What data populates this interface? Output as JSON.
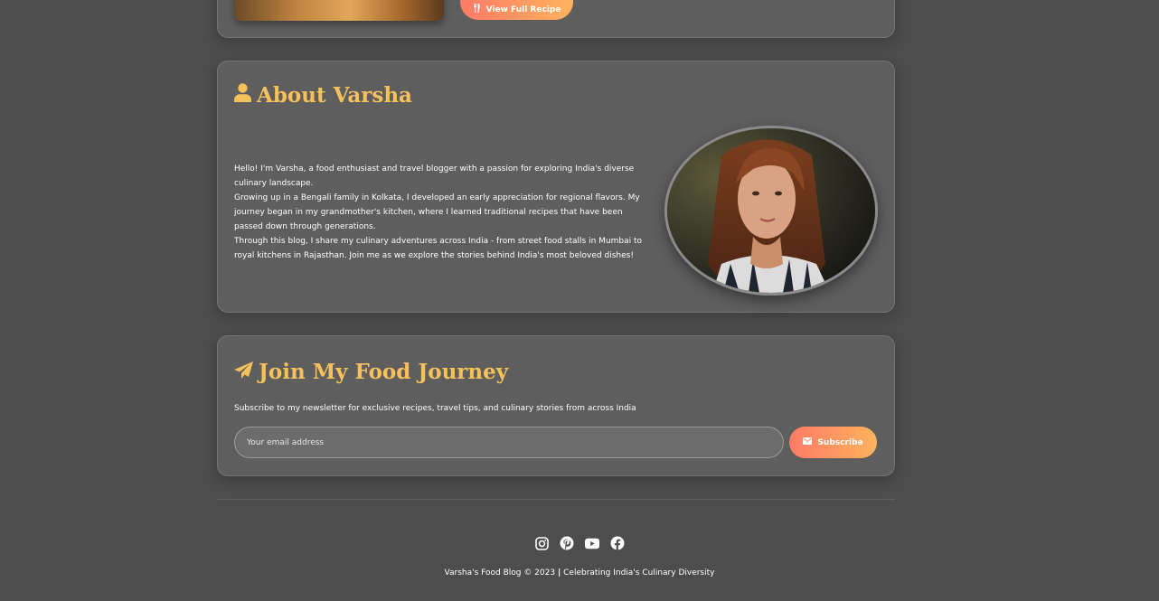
{
  "recipe_card": {
    "button_label": "View Full Recipe",
    "button_icon": "utensils-icon"
  },
  "about": {
    "title": "About Varsha",
    "title_icon": "user-icon",
    "paragraphs": [
      "Hello! I'm Varsha, a food enthusiast and travel blogger with a passion for exploring India's diverse culinary landscape.",
      "Growing up in a Bengali family in Kolkata, I developed an early appreciation for regional flavors. My journey began in my grandmother's kitchen, where I learned traditional recipes that have been passed down through generations.",
      "Through this blog, I share my culinary adventures across India - from street food stalls in Mumbai to royal kitchens in Rajasthan. Join me as we explore the stories behind India's most beloved dishes!"
    ]
  },
  "newsletter": {
    "title": "Join My Food Journey",
    "title_icon": "paper-plane-icon",
    "description": "Subscribe to my newsletter for exclusive recipes, travel tips, and culinary stories from across India",
    "email_placeholder": "Your email address",
    "subscribe_label": "Subscribe",
    "subscribe_icon": "envelope-icon"
  },
  "footer": {
    "socials": [
      "instagram-icon",
      "pinterest-icon",
      "youtube-icon",
      "facebook-icon"
    ],
    "copyright": "Varsha's Food Blog © 2023",
    "separator": "|",
    "tagline": "Celebrating India's Culinary Diversity"
  },
  "colors": {
    "background": "#4d4d4d",
    "card": "#5e5e5e",
    "accent_title": "#f6c15b",
    "button_gradient_start": "#ff7a67",
    "button_gradient_end": "#ffb35d"
  }
}
